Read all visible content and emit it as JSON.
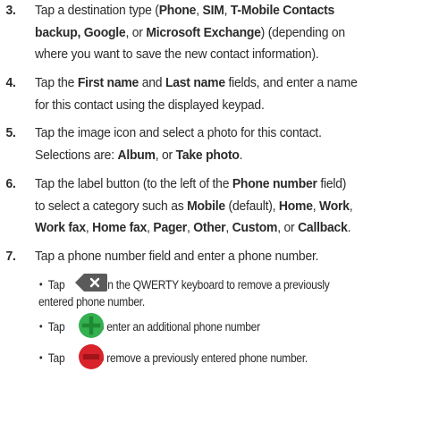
{
  "steps": [
    {
      "number": "3.",
      "lines": [
        [
          "Tap a destination type (",
          "Phone",
          ", ",
          "SIM",
          ", ",
          "T-Mobile Contacts"
        ],
        [
          "backup, Google",
          ", or ",
          "Microsoft Exchange",
          ") (depending on"
        ],
        [
          "where you want to save the new contact information)."
        ]
      ]
    },
    {
      "number": "4.",
      "lines": [
        [
          "Tap the ",
          "First name",
          " and ",
          "Last name",
          " fields, and enter a name"
        ],
        [
          "for this contact using the displayed keypad."
        ]
      ]
    },
    {
      "number": "5.",
      "lines": [
        [
          "Tap the image icon and select a photo for this contact."
        ],
        [
          "Selections are: ",
          "Album",
          ", or ",
          "Take photo",
          "."
        ]
      ]
    },
    {
      "number": "6.",
      "lines": [
        [
          "Tap the label button (to the left of the ",
          "Phone number",
          " field)"
        ],
        [
          "to select a category such as ",
          "Mobile",
          " (default), ",
          "Home",
          ", ",
          "Work",
          ","
        ],
        [
          "Work fax",
          ", ",
          "Home fax",
          ", ",
          "Pager",
          ", ",
          "Other",
          ", ",
          "Custom",
          ", or ",
          "Callback",
          "."
        ]
      ]
    },
    {
      "number": "7.",
      "lines": [
        [
          "Tap a phone number field and enter a phone number."
        ]
      ]
    }
  ],
  "substeps": [
    {
      "bullet": "•",
      "tap": "Tap",
      "icon": "backspace-key-icon",
      "rest": "on the QWERTY keyboard to remove a previously",
      "rest2": "entered phone number."
    },
    {
      "bullet": "•",
      "tap": "Tap",
      "icon": "add-green-circle-icon",
      "rest": "to enter an additional phone number"
    },
    {
      "bullet": "•",
      "tap": "Tap",
      "icon": "remove-red-circle-icon",
      "rest": "to remove a previously entered phone number."
    }
  ],
  "colors": {
    "text": "#2b2b2b",
    "key_bg": "#5a5a5a",
    "add_green": "#35b050",
    "remove_red": "#d8232a"
  }
}
